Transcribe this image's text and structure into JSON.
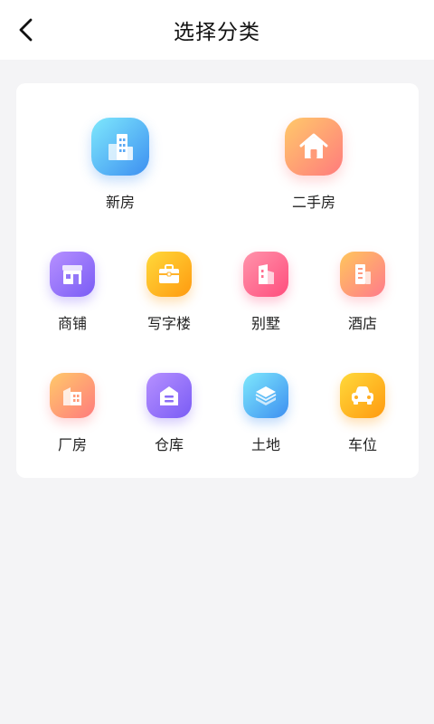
{
  "header": {
    "title": "选择分类"
  },
  "categories": {
    "row1": [
      {
        "label": "新房",
        "icon": "buildings-icon",
        "color_from": "#6fe3fb",
        "color_to": "#3a8ff0"
      },
      {
        "label": "二手房",
        "icon": "house-icon",
        "color_from": "#ffc46a",
        "color_to": "#ff7a7a"
      }
    ],
    "row2": [
      {
        "label": "商铺",
        "icon": "storefront-icon",
        "color_from": "#b18bff",
        "color_to": "#7a5cf5"
      },
      {
        "label": "写字楼",
        "icon": "briefcase-icon",
        "color_from": "#ffd43a",
        "color_to": "#ff9a10"
      },
      {
        "label": "别墅",
        "icon": "villa-icon",
        "color_from": "#ff8fa8",
        "color_to": "#ff4d7d"
      },
      {
        "label": "酒店",
        "icon": "hotel-icon",
        "color_from": "#ffc15c",
        "color_to": "#ff7a8c"
      }
    ],
    "row3": [
      {
        "label": "厂房",
        "icon": "factory-icon",
        "color_from": "#ffc46a",
        "color_to": "#ff7a7a"
      },
      {
        "label": "仓库",
        "icon": "warehouse-icon",
        "color_from": "#b18bff",
        "color_to": "#7a5cf5"
      },
      {
        "label": "土地",
        "icon": "layers-icon",
        "color_from": "#6fe3fb",
        "color_to": "#3a8ff0"
      },
      {
        "label": "车位",
        "icon": "car-icon",
        "color_from": "#ffd43a",
        "color_to": "#ff9a10"
      }
    ]
  }
}
